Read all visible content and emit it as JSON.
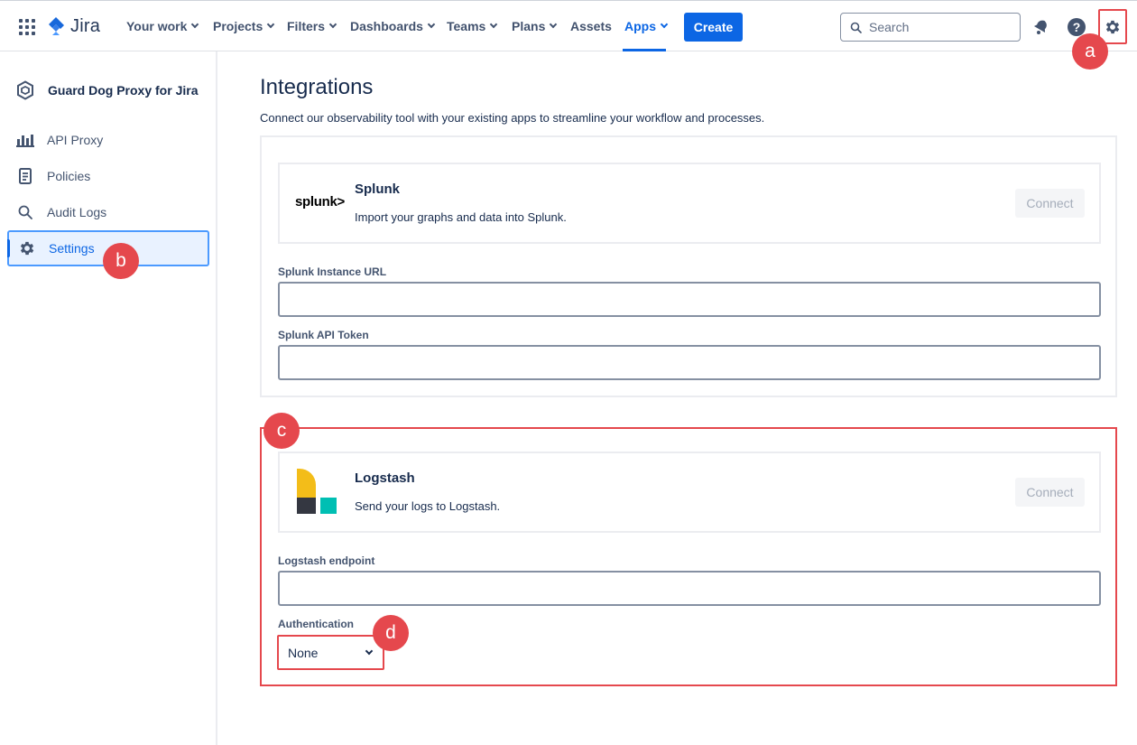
{
  "topnav": {
    "logo": "Jira",
    "items": [
      {
        "label": "Your work",
        "dropdown": true
      },
      {
        "label": "Projects",
        "dropdown": true
      },
      {
        "label": "Filters",
        "dropdown": true
      },
      {
        "label": "Dashboards",
        "dropdown": true
      },
      {
        "label": "Teams",
        "dropdown": true
      },
      {
        "label": "Plans",
        "dropdown": true
      },
      {
        "label": "Assets",
        "dropdown": false
      },
      {
        "label": "Apps",
        "dropdown": true,
        "active": true
      }
    ],
    "create_label": "Create",
    "search_placeholder": "Search",
    "icons": [
      "app-switcher-icon",
      "notifications-icon",
      "help-icon",
      "settings-icon"
    ]
  },
  "annotations": {
    "a": "a",
    "b": "b",
    "c": "c",
    "d": "d"
  },
  "sidebar": {
    "header": "Guard Dog Proxy for Jira",
    "items": [
      {
        "label": "API Proxy",
        "icon": "bar-chart-icon"
      },
      {
        "label": "Policies",
        "icon": "document-icon"
      },
      {
        "label": "Audit Logs",
        "icon": "search-icon"
      },
      {
        "label": "Settings",
        "icon": "gear-icon",
        "selected": true
      }
    ]
  },
  "main": {
    "title": "Integrations",
    "description": "Connect our observability tool with your existing apps to streamline your workflow and processes.",
    "splunk": {
      "logo_text": "splunk>",
      "title": "Splunk",
      "description": "Import your graphs and data into Splunk.",
      "connect_label": "Connect",
      "url_label": "Splunk Instance URL",
      "url_value": "",
      "token_label": "Splunk API Token",
      "token_value": ""
    },
    "logstash": {
      "title": "Logstash",
      "description": "Send your logs to Logstash.",
      "connect_label": "Connect",
      "endpoint_label": "Logstash endpoint",
      "endpoint_value": "",
      "auth_label": "Authentication",
      "auth_value": "None"
    }
  },
  "colors": {
    "accent": "#0c66e4",
    "annotation": "#e5484d",
    "logstash_yellow": "#f3bd19",
    "logstash_dark": "#343741",
    "logstash_teal": "#00bfb3"
  }
}
